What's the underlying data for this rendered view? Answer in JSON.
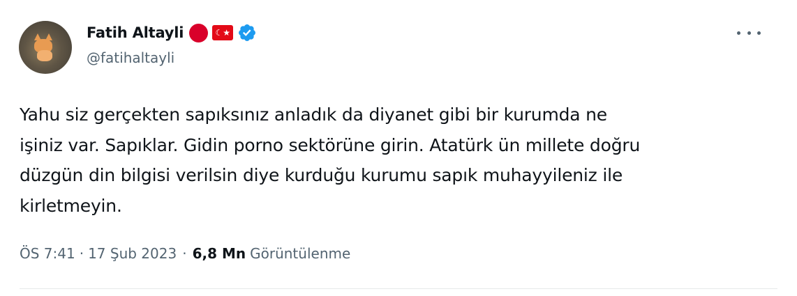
{
  "user": {
    "display_name": "Fatih Altayli",
    "handle": "@fatihaltayli",
    "badges": [
      "red-circle-icon",
      "turkey-flag-icon",
      "verified-badge-icon"
    ],
    "flag_glyph": "☾★"
  },
  "tweet": {
    "lines": [
      "Yahu siz gerçekten sapıksınız anladık da diyanet gibi bir kurumda ne",
      "işiniz var. Sapıklar. Gidin porno sektörüne girin. Atatürk ün millete doğru",
      "düzgün din bilgisi verilsin diye kurduğu kurumu sapık muhayyileniz ile",
      "kirletmeyin."
    ]
  },
  "meta": {
    "time": "ÖS 7:41",
    "separator": "·",
    "date": "17 Şub 2023",
    "views_count": "6,8 Mn",
    "views_label": "Görüntülenme"
  },
  "colors": {
    "text_primary": "#0f1419",
    "text_secondary": "#536471",
    "verified_blue": "#1d9bf0",
    "red_dot": "#d9002a",
    "flag_red": "#e30a17"
  }
}
